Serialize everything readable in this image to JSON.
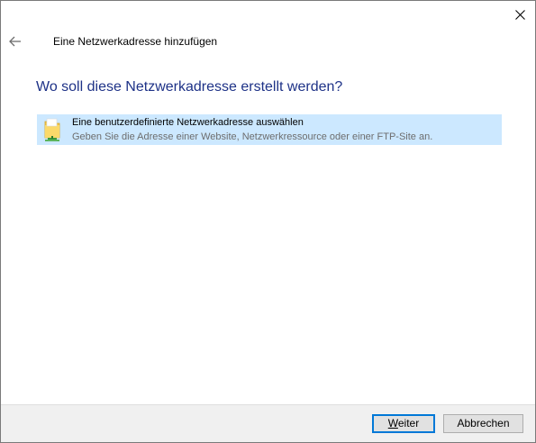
{
  "window": {
    "title": "Eine Netzwerkadresse hinzufügen"
  },
  "main": {
    "question": "Wo soll diese Netzwerkadresse erstellt werden?",
    "options": [
      {
        "title": "Eine benutzerdefinierte Netzwerkadresse auswählen",
        "description": "Geben Sie die Adresse einer Website, Netzwerkressource oder einer FTP-Site an.",
        "icon": "folder-network-icon",
        "selected": true
      }
    ]
  },
  "footer": {
    "next_label_accel": "W",
    "next_label_rest": "eiter",
    "cancel_label": "Abbrechen"
  },
  "colors": {
    "accent": "#1e3287",
    "selection": "#cce8ff",
    "footer_bg": "#f0f0f0",
    "default_button_border": "#0078d7"
  },
  "icons": {
    "close": "close-icon",
    "back": "back-arrow-icon"
  }
}
